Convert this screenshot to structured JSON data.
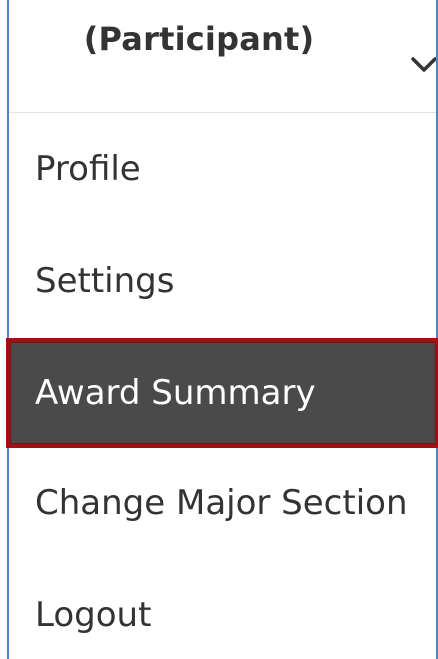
{
  "header": {
    "role_label": "(Participant)",
    "chevron_icon": "chevron-down-icon"
  },
  "menu": {
    "items": [
      {
        "label": "Profile",
        "active": false
      },
      {
        "label": "Settings",
        "active": false
      },
      {
        "label": "Award Summary",
        "active": true
      },
      {
        "label": "Change Major Section",
        "active": false
      },
      {
        "label": "Logout",
        "active": false
      }
    ]
  },
  "colors": {
    "border_accent": "#4a86c8",
    "active_background": "#4a4a4a",
    "active_outline": "#a30f12",
    "text": "#333333",
    "active_text": "#ffffff"
  }
}
